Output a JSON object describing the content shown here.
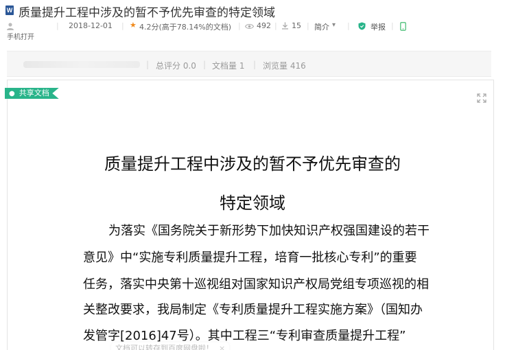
{
  "header": {
    "title": "质量提升工程中涉及的暂不予优先审查的特定领域",
    "file_type": "W"
  },
  "meta": {
    "date": "2018-12-01",
    "score": "4.2分(高于78.14%的文档)",
    "views": "492",
    "downloads": "15",
    "intro": "简介",
    "report": "举报",
    "phone_open": "手机打开"
  },
  "stats": {
    "total_score": "总评分 0.0",
    "doc_count": "文档量 1",
    "view_count": "浏览量 416"
  },
  "document": {
    "share_tag": "共享文档",
    "heading_line1": "质量提升工程中涉及的暂不予优先审查的",
    "heading_line2": "特定领域",
    "lines": [
      "为落实《国务院关于新形势下加快知识产权强国建设的若干",
      "意见》中“实施专利质量提升工程，培育一批核心专利”的重要",
      "任务，落实中央第十巡视组对国家知识产权局党组专项巡视的相",
      "关整改要求，我局制定《专利质量提升工程实施方案》（国知办",
      "发管字[2016]47号）。其中工程三“专利审查质量提升工程”"
    ]
  },
  "save_tip": "文档可以转存到百度网盘啦！",
  "colors": {
    "accent_green": "#29b48a",
    "star_orange": "#f08a1c",
    "word_blue": "#2b5797"
  },
  "icons": [
    "word-doc-icon",
    "user-icon",
    "star-icon",
    "eye-icon",
    "download-icon",
    "chevron-down-icon",
    "shield-icon",
    "phone-icon",
    "expand-icon",
    "close-icon"
  ]
}
